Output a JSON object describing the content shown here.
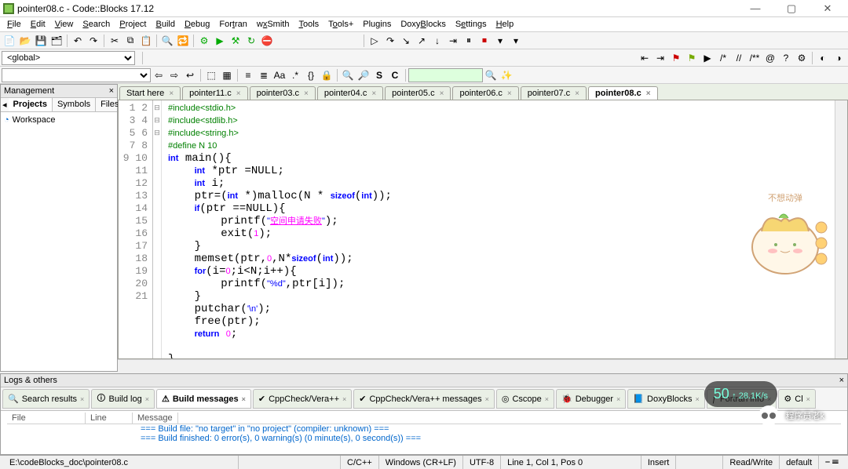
{
  "window": {
    "title": "pointer08.c - Code::Blocks 17.12"
  },
  "menu": [
    "File",
    "Edit",
    "View",
    "Search",
    "Project",
    "Build",
    "Debug",
    "Fortran",
    "wxSmith",
    "Tools",
    "Tools+",
    "Plugins",
    "DoxyBlocks",
    "Settings",
    "Help"
  ],
  "menu_underline": [
    0,
    0,
    0,
    0,
    0,
    0,
    0,
    3,
    1,
    0,
    1,
    3,
    4,
    1,
    0
  ],
  "compiler_combo": "<global>",
  "mgmt": {
    "title": "Management",
    "tabs": [
      "Projects",
      "Symbols",
      "Files"
    ],
    "workspace": "Workspace"
  },
  "file_tabs": [
    "Start here",
    "pointer11.c",
    "pointer03.c",
    "pointer04.c",
    "pointer05.c",
    "pointer06.c",
    "pointer07.c",
    "pointer08.c"
  ],
  "active_tab": 7,
  "code_lines": [
    {
      "n": 1,
      "f": "",
      "h": "<span class='pp'>#include&lt;stdio.h&gt;</span>"
    },
    {
      "n": 2,
      "f": "",
      "h": "<span class='pp'>#include&lt;stdlib.h&gt;</span>"
    },
    {
      "n": 3,
      "f": "",
      "h": "<span class='pp'>#include&lt;string.h&gt;</span>"
    },
    {
      "n": 4,
      "f": "",
      "h": "<span class='pp'>#define N 10</span>"
    },
    {
      "n": 5,
      "f": "⊟",
      "h": "<span class='kw'>int</span> main(){"
    },
    {
      "n": 6,
      "f": "",
      "h": "    <span class='kw'>int</span> *ptr =NULL;"
    },
    {
      "n": 7,
      "f": "",
      "h": "    <span class='kw'>int</span> i;"
    },
    {
      "n": 8,
      "f": "",
      "h": "    ptr=(<span class='kw'>int</span> *)malloc(N * <span class='kw'>sizeof</span>(<span class='kw'>int</span>));"
    },
    {
      "n": 9,
      "f": "⊟",
      "h": "    <span class='kw'>if</span>(ptr ==NULL){"
    },
    {
      "n": 10,
      "f": "",
      "h": "        printf(<span class='str'>\"</span><span class='strcn'>空间申请失败</span><span class='str'>\"</span>);"
    },
    {
      "n": 11,
      "f": "",
      "h": "        exit(<span class='num'>1</span>);"
    },
    {
      "n": 12,
      "f": "",
      "h": "    }"
    },
    {
      "n": 13,
      "f": "",
      "h": "    memset(ptr,<span class='num'>0</span>,N*<span class='kw'>sizeof</span>(<span class='kw'>int</span>));"
    },
    {
      "n": 14,
      "f": "⊟",
      "h": "    <span class='kw'>for</span>(i=<span class='num'>0</span>;i&lt;N;i++){"
    },
    {
      "n": 15,
      "f": "",
      "h": "        printf(<span class='str'>\"%d\"</span>,ptr[i]);"
    },
    {
      "n": 16,
      "f": "",
      "h": "    }"
    },
    {
      "n": 17,
      "f": "",
      "h": "    putchar(<span class='str'>'\\n'</span>);"
    },
    {
      "n": 18,
      "f": "",
      "h": "    free(ptr);"
    },
    {
      "n": 19,
      "f": "",
      "h": "    <span class='kw'>return</span> <span class='num'>0</span>;"
    },
    {
      "n": 20,
      "f": "",
      "h": ""
    },
    {
      "n": 21,
      "f": "",
      "h": "}"
    }
  ],
  "logs": {
    "title": "Logs & others",
    "tabs": [
      "Search results",
      "Build log",
      "Build messages",
      "CppCheck/Vera++",
      "CppCheck/Vera++ messages",
      "Cscope",
      "Debugger",
      "DoxyBlocks",
      "Fortran info",
      "Cl"
    ],
    "active": 2,
    "columns": [
      "File",
      "Line",
      "Message"
    ],
    "msg1": "=== Build file: \"no target\" in \"no project\" (compiler: unknown) ===",
    "msg2": "=== Build finished: 0 error(s), 0 warning(s) (0 minute(s), 0 second(s)) ==="
  },
  "status": {
    "path": "E:\\codeBlocks_doc\\pointer08.c",
    "lang": "C/C++",
    "eol": "Windows (CR+LF)",
    "enc": "UTF-8",
    "pos": "Line 1, Col 1, Pos 0",
    "ins": "Insert",
    "rw": "Read/Write",
    "prof": "default"
  },
  "overlay": {
    "badge_top": "50",
    "badge_sub": "↑ 28.1K/s",
    "wm_text": "程序员老k",
    "char_label": "不想动弹"
  }
}
